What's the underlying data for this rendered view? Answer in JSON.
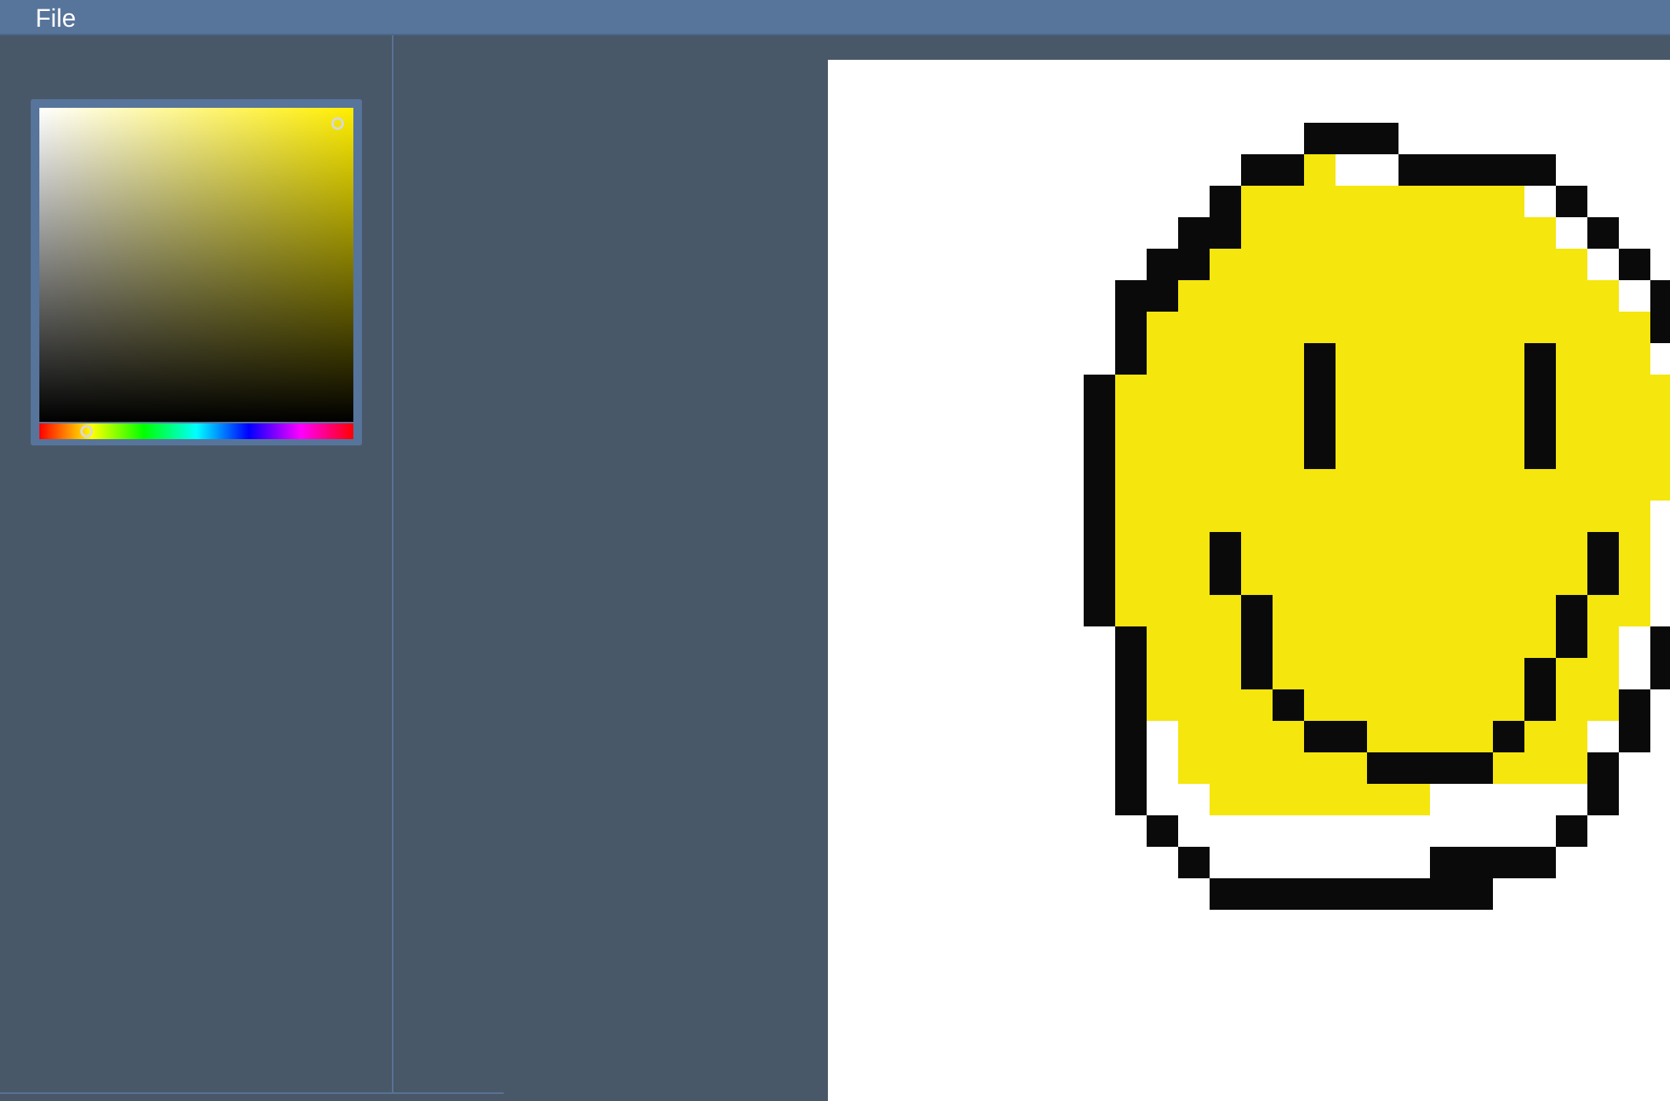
{
  "menu": {
    "file_label": "File"
  },
  "color_picker": {
    "current_color": "#f5e60d",
    "hue_fraction": 0.15,
    "saturation": 0.95,
    "brightness": 0.95
  },
  "canvas": {
    "background": "#ffffff",
    "fill_color": "#f5e60d",
    "outline_color": "#0a0a0a"
  }
}
